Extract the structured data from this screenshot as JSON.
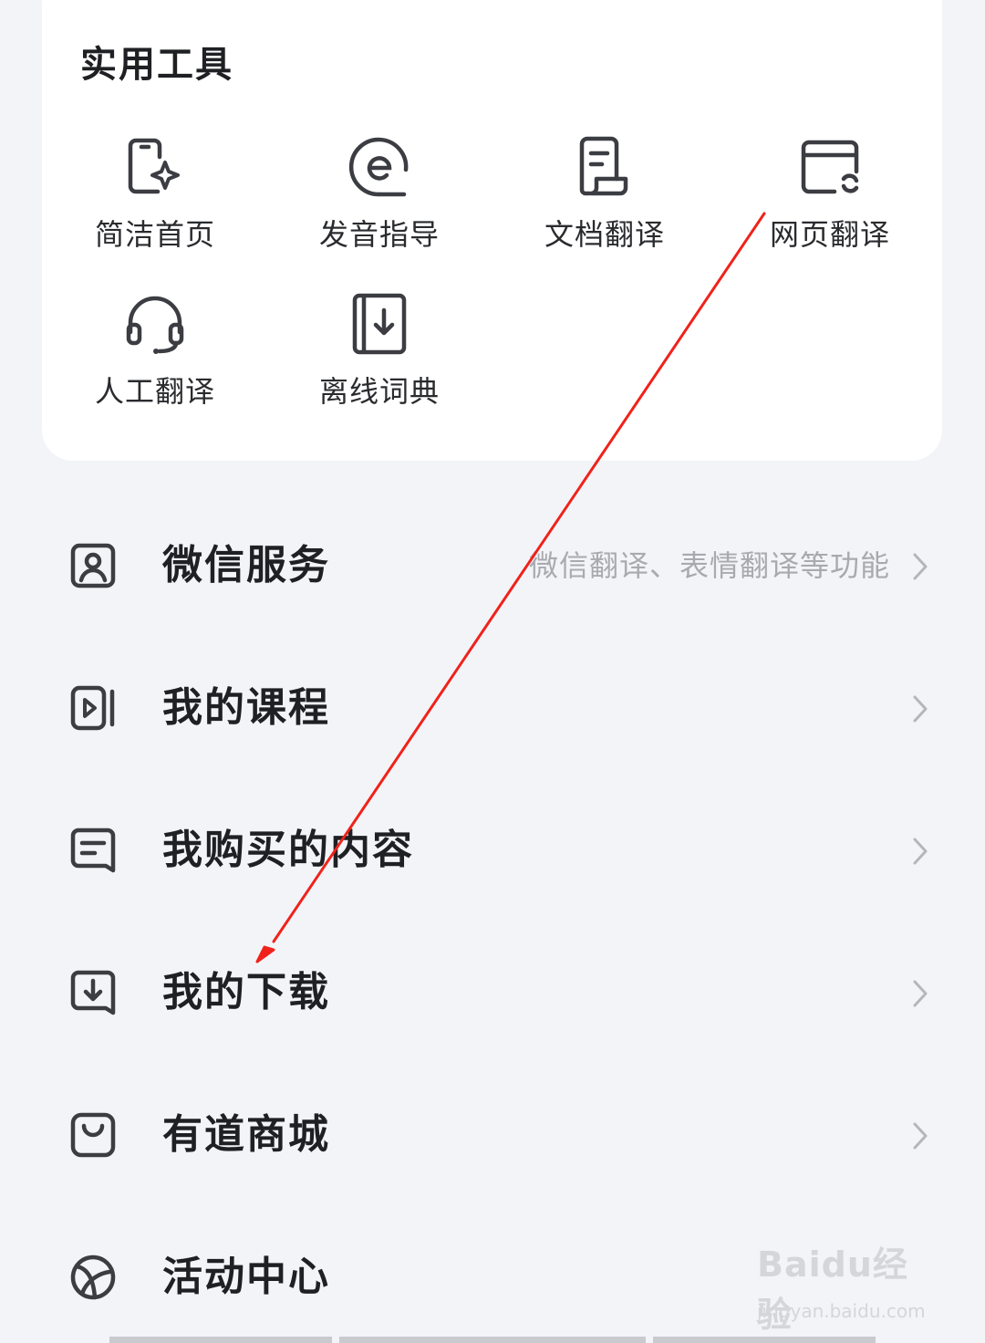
{
  "tools": {
    "title": "实用工具",
    "items": [
      {
        "label": "简洁首页",
        "icon": "phone-sparkle-icon"
      },
      {
        "label": "发音指导",
        "icon": "pronunciation-icon"
      },
      {
        "label": "文档翻译",
        "icon": "document-icon"
      },
      {
        "label": "网页翻译",
        "icon": "webpage-translate-icon"
      },
      {
        "label": "人工翻译",
        "icon": "headset-icon"
      },
      {
        "label": "离线词典",
        "icon": "offline-dictionary-icon"
      }
    ]
  },
  "menu": [
    {
      "label": "微信服务",
      "subtitle": "微信翻译、表情翻译等功能",
      "icon": "wechat-person-icon"
    },
    {
      "label": "我的课程",
      "subtitle": "",
      "icon": "course-video-icon"
    },
    {
      "label": "我购买的内容",
      "subtitle": "",
      "icon": "purchased-content-icon"
    },
    {
      "label": "我的下载",
      "subtitle": "",
      "icon": "download-icon"
    },
    {
      "label": "有道商城",
      "subtitle": "",
      "icon": "shopping-bag-icon"
    },
    {
      "label": "活动中心",
      "subtitle": "",
      "icon": "ball-icon"
    }
  ],
  "watermark": {
    "brand": "Baidu经验",
    "url": "jingyan.baidu.com"
  },
  "colors": {
    "annotation_arrow": "#f0221b",
    "background": "#f3f4f7",
    "card": "#ffffff",
    "icon_stroke": "#3b3d42"
  }
}
